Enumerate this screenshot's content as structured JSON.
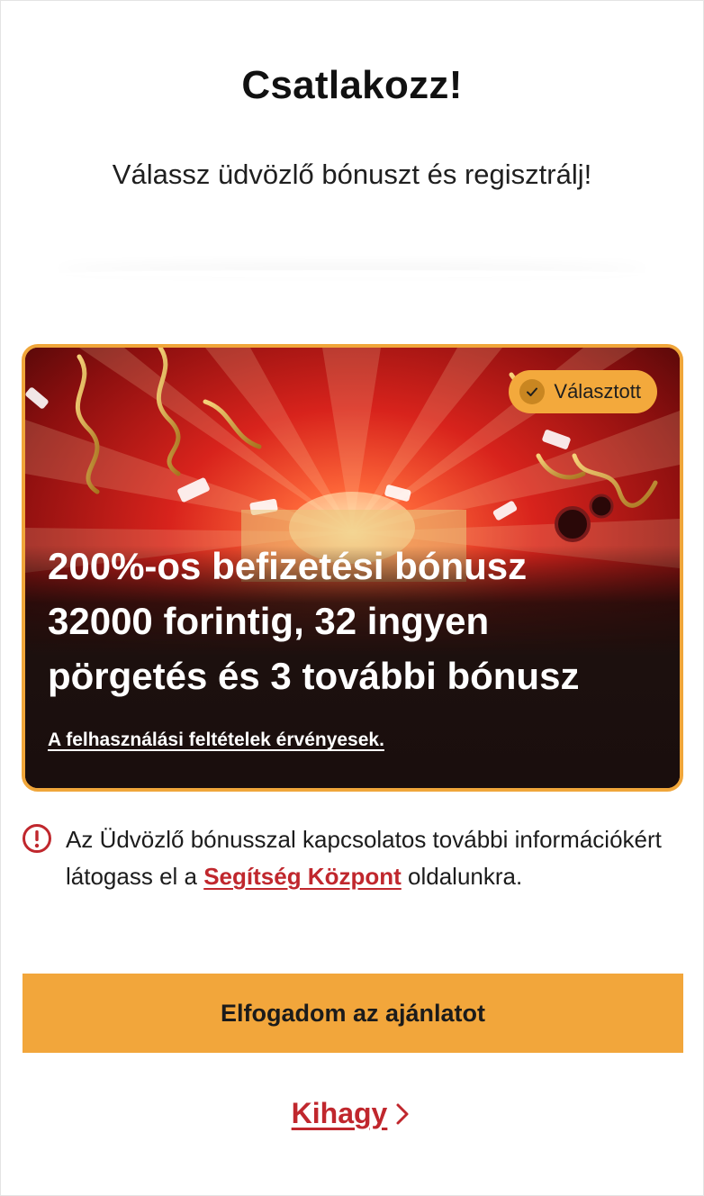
{
  "header": {
    "title": "Csatlakozz!",
    "subtitle": "Válassz üdvözlő bónuszt és regisztrálj!"
  },
  "bonus_card": {
    "selected_badge": "Választott",
    "offer_lines": [
      "200%-os befizetési bónusz",
      "32000 forintig, 32 ingyen",
      "pörgetés és 3 további bónusz"
    ],
    "terms_link": "A felhasználási feltételek érvényesek.",
    "border_color": "#f0a63a"
  },
  "info": {
    "text_before": "Az Üdvözlő bónusszal kapcsolatos további információkért látogass el a ",
    "link": "Segítség Központ",
    "text_after": " oldalunkra."
  },
  "actions": {
    "accept_label": "Elfogadom az ajánlatot",
    "skip_label": "Kihagy"
  },
  "colors": {
    "accent": "#f2a63b",
    "link_red": "#c0272d"
  }
}
